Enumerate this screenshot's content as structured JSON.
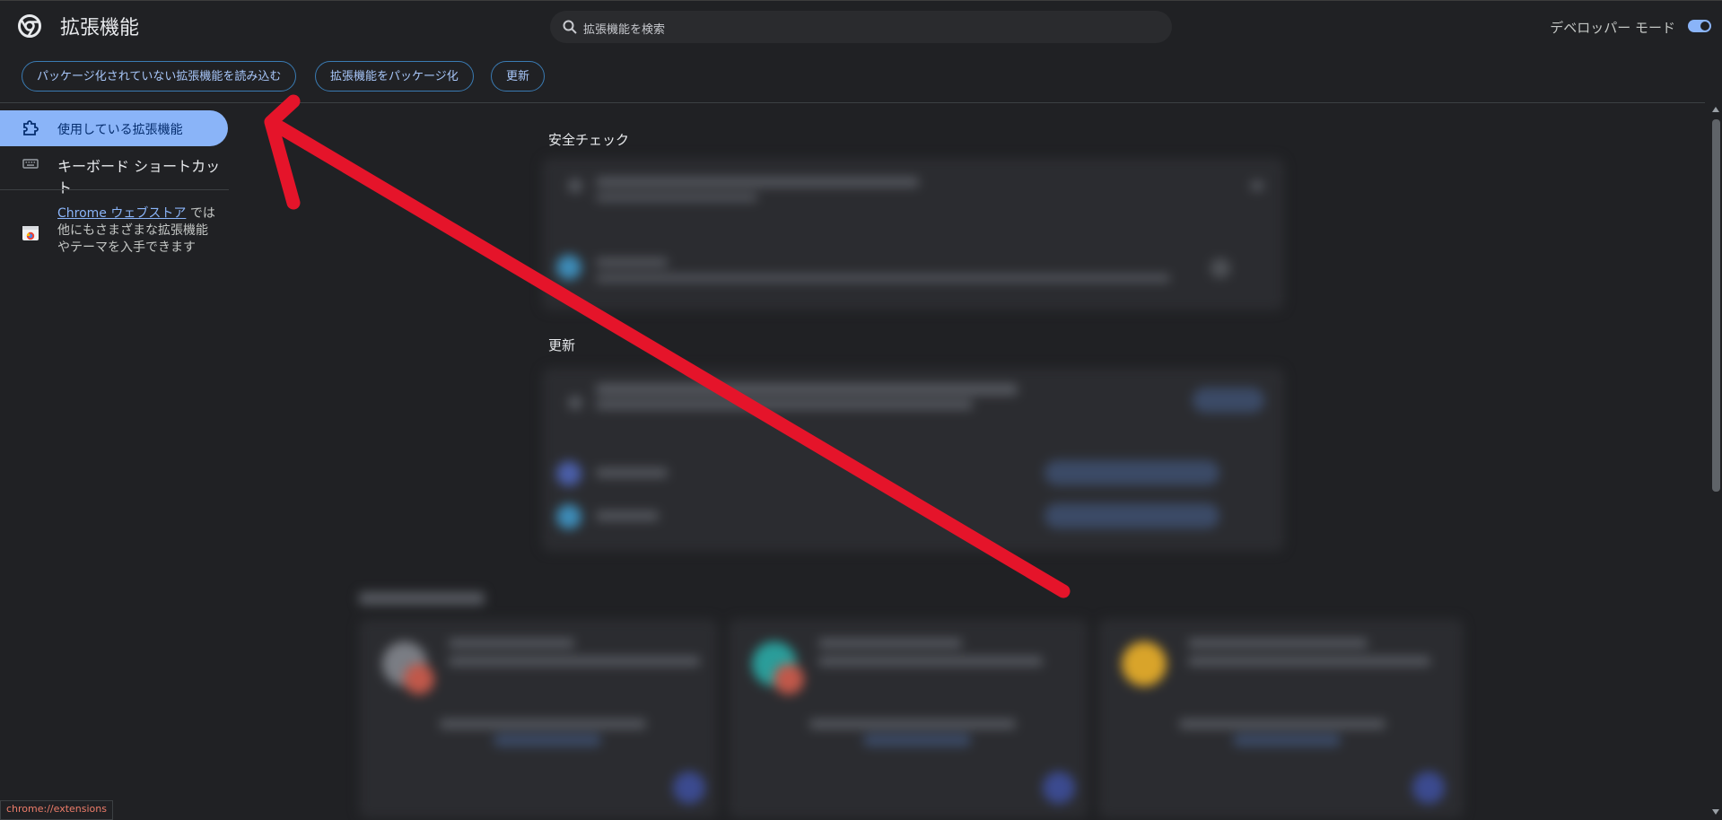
{
  "header": {
    "title": "拡張機能",
    "search_placeholder": "拡張機能を検索",
    "developer_mode_label": "デベロッパー モード",
    "developer_mode_on": true
  },
  "toolbar": {
    "load_unpacked": "パッケージ化されていない拡張機能を読み込む",
    "pack_extension": "拡張機能をパッケージ化",
    "update": "更新"
  },
  "sidebar": {
    "items": [
      {
        "label": "使用している拡張機能",
        "icon": "puzzle-icon",
        "active": true
      },
      {
        "label": "キーボード ショートカット",
        "icon": "keyboard-icon",
        "active": false
      }
    ],
    "store": {
      "link_text": "Chrome ウェブストア",
      "text_line1": "では",
      "text_line2": "他にもさまざまな拡張機能",
      "text_line3": "やテーマを入手できます",
      "icon": "webstore-icon"
    }
  },
  "main": {
    "safety_check_title": "安全チェック",
    "updates_title": "更新"
  },
  "status_bar": {
    "url": "chrome://extensions"
  },
  "colors": {
    "background": "#202124",
    "accent": "#8ab4f8",
    "annotation_arrow": "#e5142a"
  }
}
